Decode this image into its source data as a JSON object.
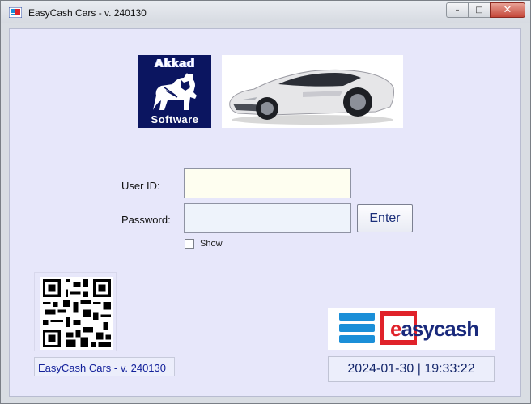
{
  "window": {
    "title": "EasyCash Cars - v. 240130",
    "buttons": {
      "minimize": "–",
      "maximize": "□",
      "close": "✕"
    }
  },
  "branding": {
    "company_line1": "Akkad",
    "company_line2": "Software",
    "product_first_letter": "e",
    "product_rest": "asycash",
    "colors": {
      "akkad_bg": "#0b1560",
      "easycash_blue": "#1b8fd8",
      "easycash_red": "#e0222a",
      "easycash_navy": "#1a2a7c"
    }
  },
  "login": {
    "user_label": "User ID:",
    "user_value": "",
    "password_label": "Password:",
    "password_value": "",
    "enter_label": "Enter",
    "show_label": "Show",
    "show_checked": false
  },
  "footer": {
    "version_text": "EasyCash Cars - v. 240130",
    "date": "2024-01-30",
    "separator": "|",
    "time": "19:33:22"
  }
}
